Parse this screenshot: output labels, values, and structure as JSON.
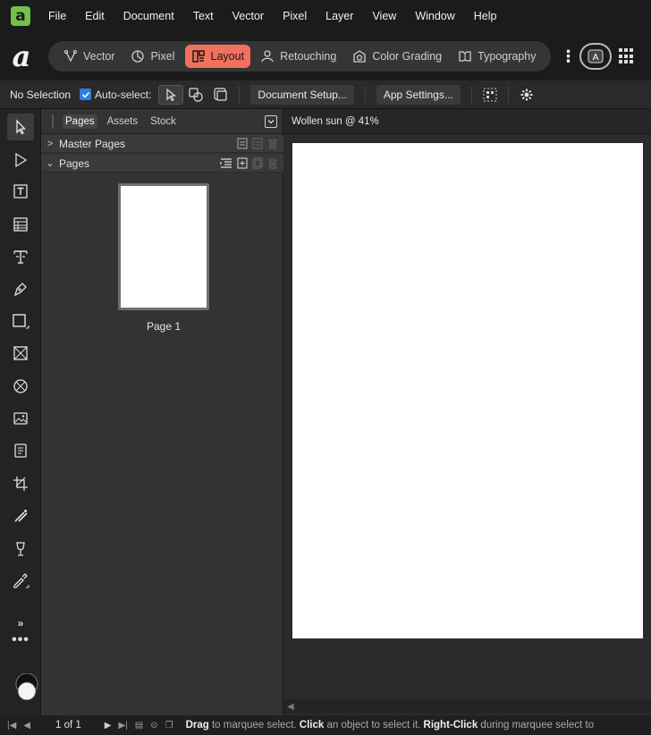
{
  "menubar": {
    "items": [
      "File",
      "Edit",
      "Document",
      "Text",
      "Vector",
      "Pixel",
      "Layer",
      "View",
      "Window",
      "Help"
    ]
  },
  "personas": {
    "items": [
      {
        "label": "Vector",
        "icon": "vector-persona-icon"
      },
      {
        "label": "Pixel",
        "icon": "pixel-persona-icon"
      },
      {
        "label": "Layout",
        "icon": "layout-persona-icon",
        "active": true
      },
      {
        "label": "Retouching",
        "icon": "retouching-persona-icon"
      },
      {
        "label": "Color Grading",
        "icon": "color-grading-persona-icon"
      },
      {
        "label": "Typography",
        "icon": "typography-persona-icon"
      }
    ],
    "active_color": "#f2705d"
  },
  "context": {
    "selection": "No Selection",
    "auto_select": "Auto-select:",
    "document_setup": "Document Setup...",
    "app_settings": "App Settings..."
  },
  "panel": {
    "tabs": [
      "Pages",
      "Assets",
      "Stock"
    ],
    "active_tab": "Pages",
    "sections": {
      "master_pages": "Master Pages",
      "pages": "Pages"
    },
    "page_thumb_label": "Page 1"
  },
  "document": {
    "tab_title": "Wollen sun @ 41%"
  },
  "status": {
    "page_count": "1 of 1",
    "hint": {
      "drag": "Drag",
      "drag_text": " to marquee select. ",
      "click": "Click",
      "click_text": " an object to select it. ",
      "right_click": "Right-Click",
      "right_click_text": " during marquee select to"
    }
  },
  "colors": {
    "accent": "#f2705d",
    "brand": "#71c24c",
    "checkbox": "#2f7de1"
  }
}
